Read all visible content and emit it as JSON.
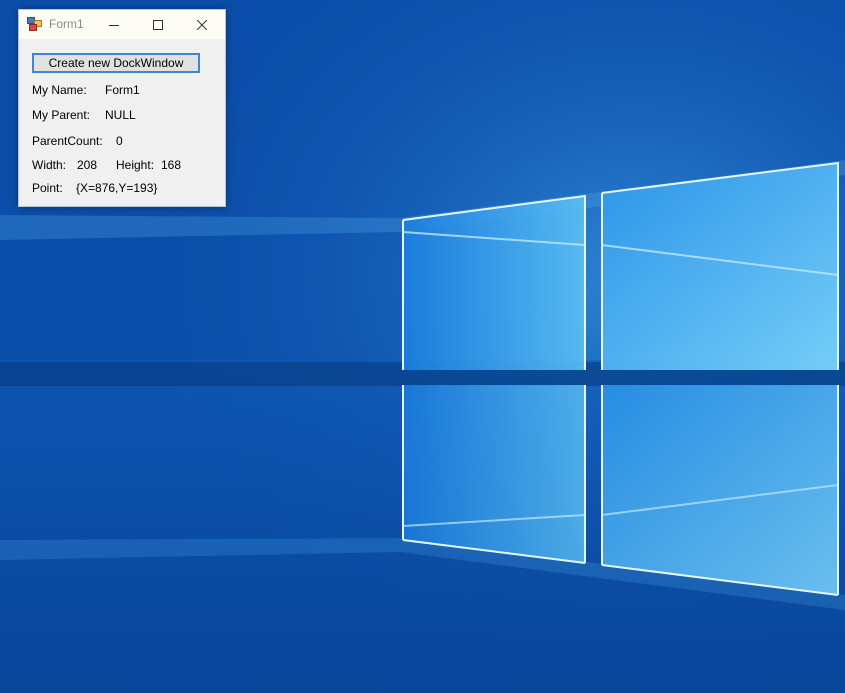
{
  "window": {
    "title": "Form1",
    "create_button_label": "Create new DockWindow",
    "my_name_label": "My Name:",
    "my_name_value": "Form1",
    "my_parent_label": "My Parent:",
    "my_parent_value": "NULL",
    "parent_count_label": "ParentCount:",
    "parent_count_value": "0",
    "width_label": "Width:",
    "width_value": "208",
    "height_label": "Height:",
    "height_value": "168",
    "point_label": "Point:",
    "point_value": "{X=876,Y=193}"
  },
  "titlebar_icons": [
    "app-icon",
    "minimize-icon",
    "maximize-icon",
    "close-icon"
  ],
  "colors": {
    "titlebar_bg": "#fdfdf6",
    "window_bg": "#f0f0f0",
    "button_focus_border": "#3c86d4",
    "desktop_blue": "#0b4fae"
  }
}
